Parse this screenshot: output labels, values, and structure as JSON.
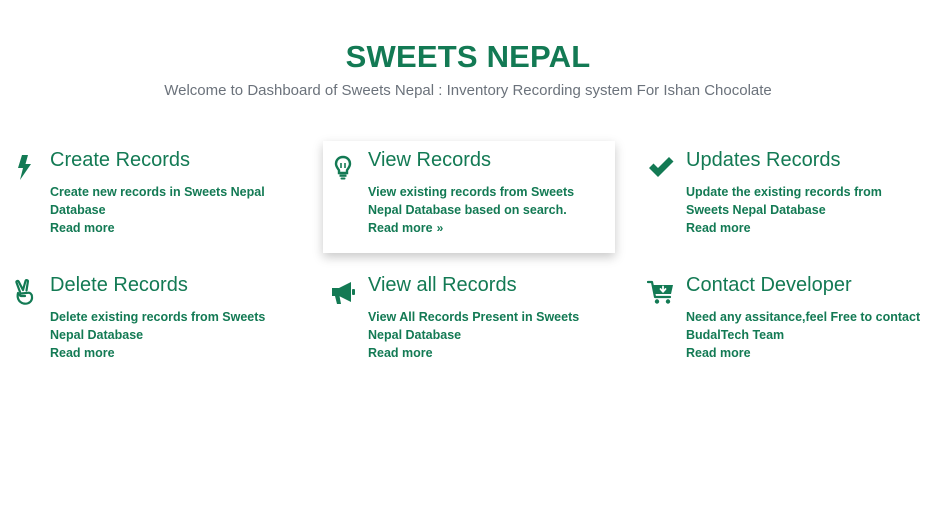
{
  "header": {
    "title": "SWEETS NEPAL",
    "subtitle": "Welcome to Dashboard of Sweets Nepal : Inventory Recording system For Ishan Chocolate"
  },
  "cards": [
    {
      "title": "Create Records",
      "desc": "Create new records in Sweets Nepal Database",
      "more": "Read more",
      "icon": "bolt-icon"
    },
    {
      "title": "View Records",
      "desc": "View existing records from Sweets Nepal Database based on search.",
      "more": "Read more",
      "more_chevron": "»",
      "icon": "lightbulb-icon"
    },
    {
      "title": "Updates Records",
      "desc": "Update the existing records from Sweets Nepal Database",
      "more": "Read more",
      "icon": "check-icon"
    },
    {
      "title": "Delete Records",
      "desc": "Delete existing records from Sweets Nepal Database",
      "more": "Read more",
      "icon": "peace-hand-icon"
    },
    {
      "title": "View all Records",
      "desc": "View All Records Present in Sweets Nepal Database",
      "more": "Read more",
      "icon": "megaphone-icon"
    },
    {
      "title": "Contact Developer",
      "desc": "Need any assitance,feel Free to contact BudalTech Team",
      "more": "Read more",
      "icon": "cart-download-icon"
    }
  ],
  "colors": {
    "accent": "#137a54",
    "subtitle": "#6b727b",
    "background": "#ffffff"
  }
}
